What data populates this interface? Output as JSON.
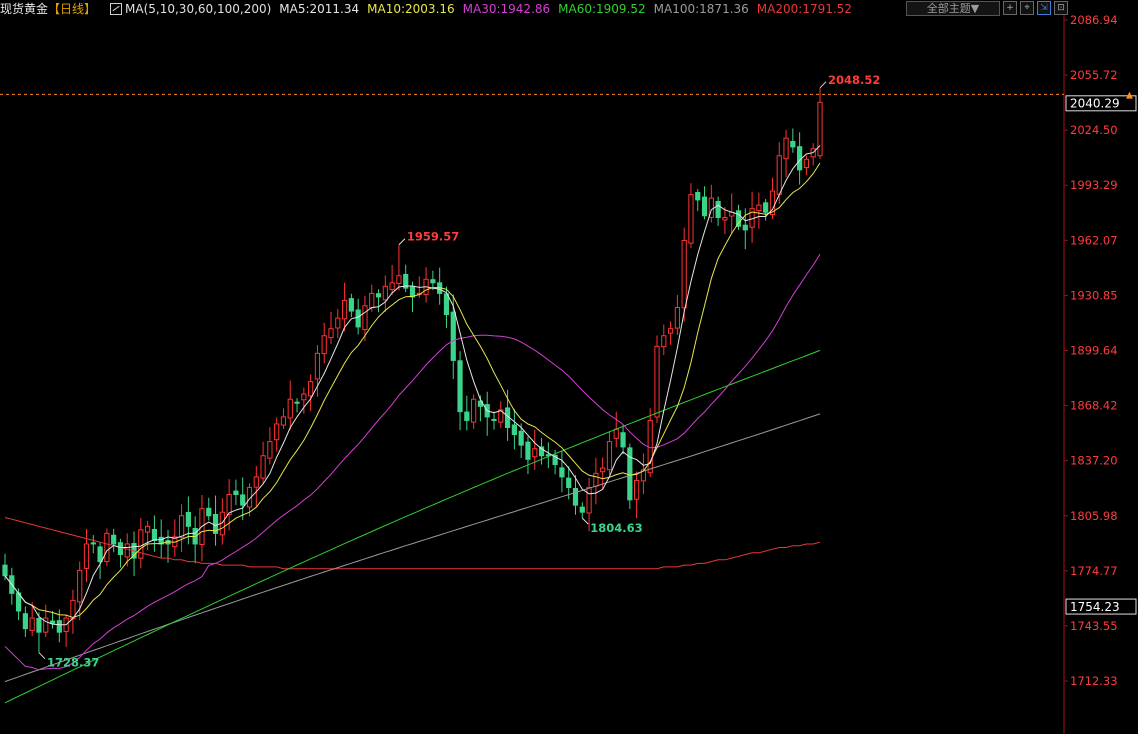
{
  "header": {
    "title": "现货黄金",
    "period": "【日线】",
    "ma_params": "MA(5,10,30,60,100,200)",
    "ma_values": [
      {
        "label": "MA5:2011.34",
        "color": "#e6e6e6"
      },
      {
        "label": "MA10:2003.16",
        "color": "#e8e64a"
      },
      {
        "label": "MA30:1942.86",
        "color": "#d43fd4"
      },
      {
        "label": "MA60:1909.52",
        "color": "#30d030"
      },
      {
        "label": "MA100:1871.36",
        "color": "#9a9a9a"
      },
      {
        "label": "MA200:1791.52",
        "color": "#e83838"
      }
    ]
  },
  "toolbar": {
    "theme_label": "全部主题▼",
    "buttons": [
      "crosshair-icon",
      "zoom-icon",
      "expand-icon",
      "settings-icon"
    ]
  },
  "colors": {
    "up": "#ff3232",
    "down": "#3ad58a",
    "axis_text": "#ff3c3c",
    "current_line": "#ff8c1a"
  },
  "chart_data": {
    "type": "candlestick",
    "title": "",
    "xlabel": "",
    "ylabel": "",
    "ylim": [
      1702,
      2094
    ],
    "y_ticks": [
      2086.94,
      2055.72,
      2024.5,
      1993.29,
      1962.07,
      1930.85,
      1899.64,
      1868.42,
      1837.2,
      1805.98,
      1774.77,
      1743.55,
      1712.33
    ],
    "current_price": "2040.29",
    "secondary_price": "1754.23",
    "annotations": [
      {
        "label": "2048.52",
        "value": 2048.52,
        "color": "#ff3c3c"
      },
      {
        "label": "1959.57",
        "value": 1959.57,
        "color": "#ff3c3c"
      },
      {
        "label": "1804.63",
        "value": 1804.63,
        "color": "#3ad58a"
      },
      {
        "label": "1728.37",
        "value": 1728.37,
        "color": "#3ad58a"
      }
    ],
    "closes": [
      1772,
      1762,
      1752,
      1742,
      1748,
      1740,
      1748,
      1745,
      1740,
      1748,
      1758,
      1775,
      1790,
      1790,
      1780,
      1796,
      1790,
      1784,
      1790,
      1782,
      1798,
      1800,
      1792,
      1790,
      1790,
      1794,
      1806,
      1800,
      1790,
      1810,
      1806,
      1796,
      1808,
      1818,
      1818,
      1812,
      1822,
      1828,
      1840,
      1848,
      1858,
      1862,
      1872,
      1870,
      1875,
      1882,
      1898,
      1908,
      1912,
      1918,
      1928,
      1922,
      1913,
      1925,
      1932,
      1930,
      1936,
      1938,
      1942,
      1935,
      1930,
      1932,
      1940,
      1938,
      1932,
      1920,
      1894,
      1865,
      1860,
      1872,
      1868,
      1862,
      1860,
      1866,
      1856,
      1852,
      1846,
      1838,
      1844,
      1840,
      1840,
      1835,
      1828,
      1822,
      1812,
      1808,
      1822,
      1830,
      1833,
      1848,
      1855,
      1845,
      1815,
      1826,
      1832,
      1860,
      1902,
      1908,
      1912,
      1924,
      1962,
      1988,
      1985,
      1976,
      1986,
      1975,
      1975,
      1978,
      1970,
      1968,
      1980,
      1982,
      1978,
      1990,
      2010,
      2020,
      2015,
      2002,
      2008,
      2014,
      2040
    ],
    "ma200": [
      1805,
      1804,
      1803,
      1802,
      1801,
      1800,
      1799,
      1798,
      1797,
      1796,
      1795,
      1794,
      1793,
      1792,
      1791,
      1790,
      1789,
      1788,
      1787,
      1786,
      1785,
      1784,
      1783,
      1782,
      1782,
      1781,
      1781,
      1780,
      1780,
      1779,
      1779,
      1779,
      1778,
      1778,
      1778,
      1778,
      1777,
      1777,
      1777,
      1777,
      1777,
      1776,
      1776,
      1776,
      1776,
      1776,
      1776,
      1776,
      1776,
      1776,
      1776,
      1776,
      1776,
      1776,
      1776,
      1776,
      1776,
      1776,
      1776,
      1776,
      1776,
      1776,
      1776,
      1776,
      1776,
      1776,
      1776,
      1776,
      1776,
      1776,
      1776,
      1776,
      1776,
      1776,
      1776,
      1776,
      1776,
      1776,
      1776,
      1776,
      1776,
      1776,
      1776,
      1776,
      1776,
      1776,
      1776,
      1776,
      1776,
      1776,
      1776,
      1776,
      1776,
      1776,
      1776,
      1776,
      1776,
      1777,
      1777,
      1777,
      1778,
      1778,
      1779,
      1779,
      1780,
      1781,
      1781,
      1782,
      1783,
      1784,
      1785,
      1785,
      1786,
      1787,
      1788,
      1788,
      1789,
      1789,
      1790,
      1790,
      1791
    ]
  }
}
